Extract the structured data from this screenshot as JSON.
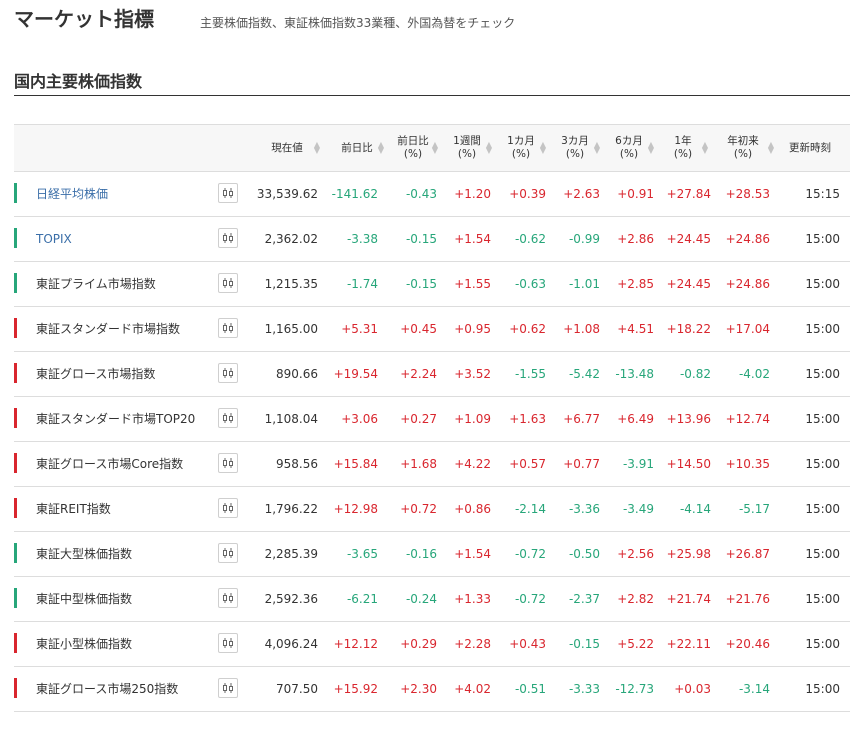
{
  "header": {
    "title": "マーケット指標",
    "subtitle": "主要株価指数、東証株価指数33業種、外国為替をチェック"
  },
  "section": {
    "title": "国内主要株価指数"
  },
  "colors": {
    "up": "#d9262e",
    "down": "#27a67a",
    "link": "#3a6ea8"
  },
  "columns": [
    {
      "l1": "現在値",
      "l2": "",
      "sortable": true
    },
    {
      "l1": "前日比",
      "l2": "",
      "sortable": true
    },
    {
      "l1": "前日比",
      "l2": "(%)",
      "sortable": true
    },
    {
      "l1": "1週間",
      "l2": "(%)",
      "sortable": true
    },
    {
      "l1": "1カ月",
      "l2": "(%)",
      "sortable": true
    },
    {
      "l1": "3カ月",
      "l2": "(%)",
      "sortable": true
    },
    {
      "l1": "6カ月",
      "l2": "(%)",
      "sortable": true
    },
    {
      "l1": "1年",
      "l2": "(%)",
      "sortable": true
    },
    {
      "l1": "年初来",
      "l2": "(%)",
      "sortable": true
    },
    {
      "l1": "更新時刻",
      "l2": "",
      "sortable": false
    }
  ],
  "rows": [
    {
      "name": "日経平均株価",
      "link": true,
      "trend": "down",
      "values": [
        "33,539.62",
        "-141.62",
        "-0.43",
        "+1.20",
        "+0.39",
        "+2.63",
        "+0.91",
        "+27.84",
        "+28.53"
      ],
      "time": "15:15"
    },
    {
      "name": "TOPIX",
      "link": true,
      "trend": "down",
      "values": [
        "2,362.02",
        "-3.38",
        "-0.15",
        "+1.54",
        "-0.62",
        "-0.99",
        "+2.86",
        "+24.45",
        "+24.86"
      ],
      "time": "15:00"
    },
    {
      "name": "東証プライム市場指数",
      "link": false,
      "trend": "down",
      "values": [
        "1,215.35",
        "-1.74",
        "-0.15",
        "+1.55",
        "-0.63",
        "-1.01",
        "+2.85",
        "+24.45",
        "+24.86"
      ],
      "time": "15:00"
    },
    {
      "name": "東証スタンダード市場指数",
      "link": false,
      "trend": "up",
      "values": [
        "1,165.00",
        "+5.31",
        "+0.45",
        "+0.95",
        "+0.62",
        "+1.08",
        "+4.51",
        "+18.22",
        "+17.04"
      ],
      "time": "15:00"
    },
    {
      "name": "東証グロース市場指数",
      "link": false,
      "trend": "up",
      "values": [
        "890.66",
        "+19.54",
        "+2.24",
        "+3.52",
        "-1.55",
        "-5.42",
        "-13.48",
        "-0.82",
        "-4.02"
      ],
      "time": "15:00"
    },
    {
      "name": "東証スタンダード市場TOP20",
      "link": false,
      "trend": "up",
      "values": [
        "1,108.04",
        "+3.06",
        "+0.27",
        "+1.09",
        "+1.63",
        "+6.77",
        "+6.49",
        "+13.96",
        "+12.74"
      ],
      "time": "15:00"
    },
    {
      "name": "東証グロース市場Core指数",
      "link": false,
      "trend": "up",
      "values": [
        "958.56",
        "+15.84",
        "+1.68",
        "+4.22",
        "+0.57",
        "+0.77",
        "-3.91",
        "+14.50",
        "+10.35"
      ],
      "time": "15:00"
    },
    {
      "name": "東証REIT指数",
      "link": false,
      "trend": "up",
      "values": [
        "1,796.22",
        "+12.98",
        "+0.72",
        "+0.86",
        "-2.14",
        "-3.36",
        "-3.49",
        "-4.14",
        "-5.17"
      ],
      "time": "15:00"
    },
    {
      "name": "東証大型株価指数",
      "link": false,
      "trend": "down",
      "values": [
        "2,285.39",
        "-3.65",
        "-0.16",
        "+1.54",
        "-0.72",
        "-0.50",
        "+2.56",
        "+25.98",
        "+26.87"
      ],
      "time": "15:00"
    },
    {
      "name": "東証中型株価指数",
      "link": false,
      "trend": "down",
      "values": [
        "2,592.36",
        "-6.21",
        "-0.24",
        "+1.33",
        "-0.72",
        "-2.37",
        "+2.82",
        "+21.74",
        "+21.76"
      ],
      "time": "15:00"
    },
    {
      "name": "東証小型株価指数",
      "link": false,
      "trend": "up",
      "values": [
        "4,096.24",
        "+12.12",
        "+0.29",
        "+2.28",
        "+0.43",
        "-0.15",
        "+5.22",
        "+22.11",
        "+20.46"
      ],
      "time": "15:00"
    },
    {
      "name": "東証グロース市場250指数",
      "link": false,
      "trend": "up",
      "values": [
        "707.50",
        "+15.92",
        "+2.30",
        "+4.02",
        "-0.51",
        "-3.33",
        "-12.73",
        "+0.03",
        "-3.14"
      ],
      "time": "15:00"
    }
  ]
}
